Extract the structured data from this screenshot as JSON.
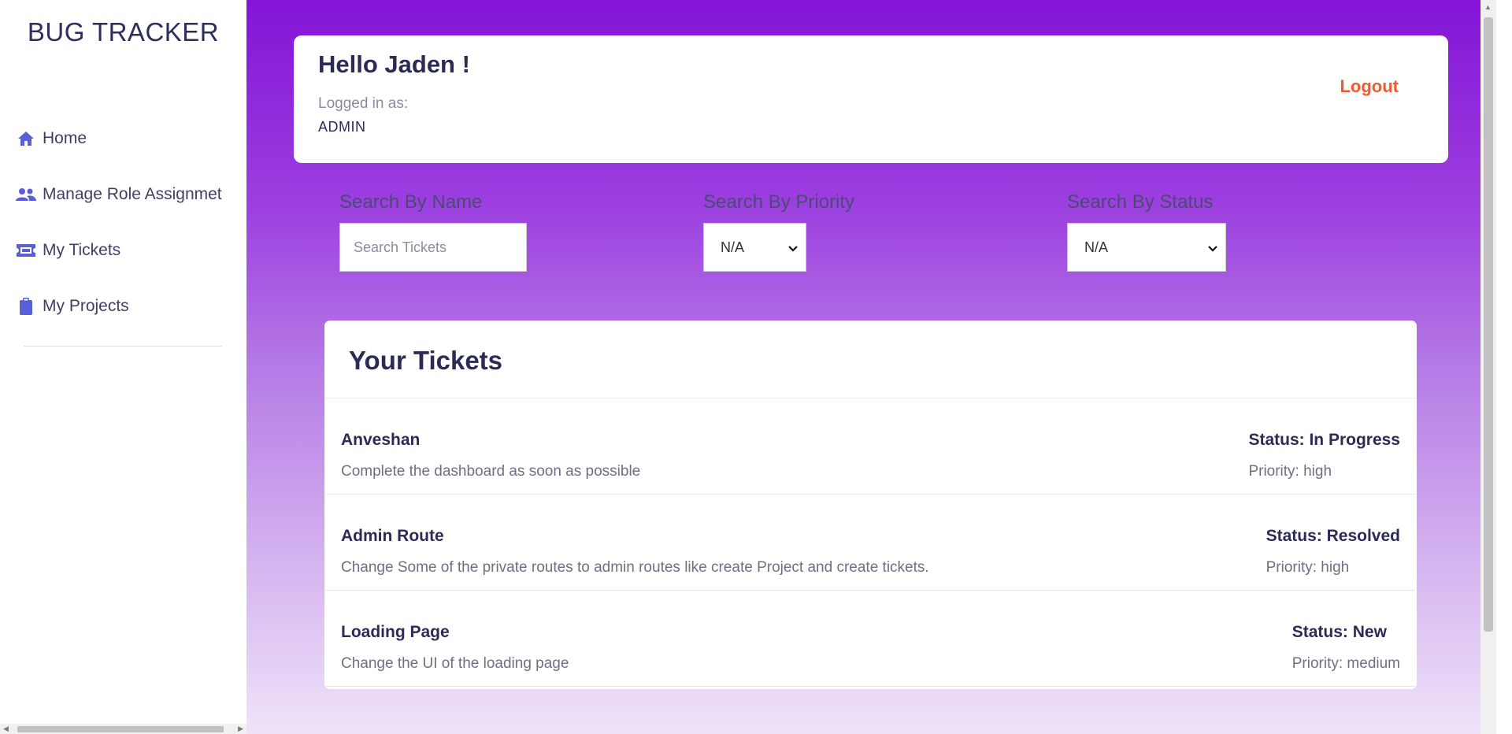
{
  "sidebar": {
    "brand": "BUG TRACKER",
    "items": [
      {
        "label": "Home",
        "icon": "home-icon"
      },
      {
        "label": "Manage Role Assignmet",
        "icon": "users-icon"
      },
      {
        "label": "My Tickets",
        "icon": "ticket-icon"
      },
      {
        "label": "My Projects",
        "icon": "clipboard-icon"
      }
    ]
  },
  "header": {
    "greeting": "Hello Jaden !",
    "logged_in_label": "Logged in as:",
    "role": "ADMIN",
    "logout_label": "Logout"
  },
  "filters": {
    "name": {
      "label": "Search By Name",
      "placeholder": "Search Tickets",
      "value": ""
    },
    "priority": {
      "label": "Search By Priority",
      "selected": "N/A"
    },
    "status": {
      "label": "Search By Status",
      "selected": "N/A"
    }
  },
  "tickets": {
    "title": "Your Tickets",
    "items": [
      {
        "name": "Anveshan",
        "description": "Complete the dashboard as soon as possible",
        "status": "Status: In Progress",
        "priority": "Priority: high"
      },
      {
        "name": "Admin Route",
        "description": "Change Some of the private routes to admin routes like create Project and create tickets.",
        "status": "Status: Resolved",
        "priority": "Priority: high"
      },
      {
        "name": "Loading Page",
        "description": "Change the UI of the loading page",
        "status": "Status: New",
        "priority": "Priority: medium"
      }
    ]
  },
  "colors": {
    "accent": "#8414d6",
    "nav_icon": "#5a5fd6",
    "logout": "#ef5a2f",
    "heading": "#2b2b55"
  }
}
